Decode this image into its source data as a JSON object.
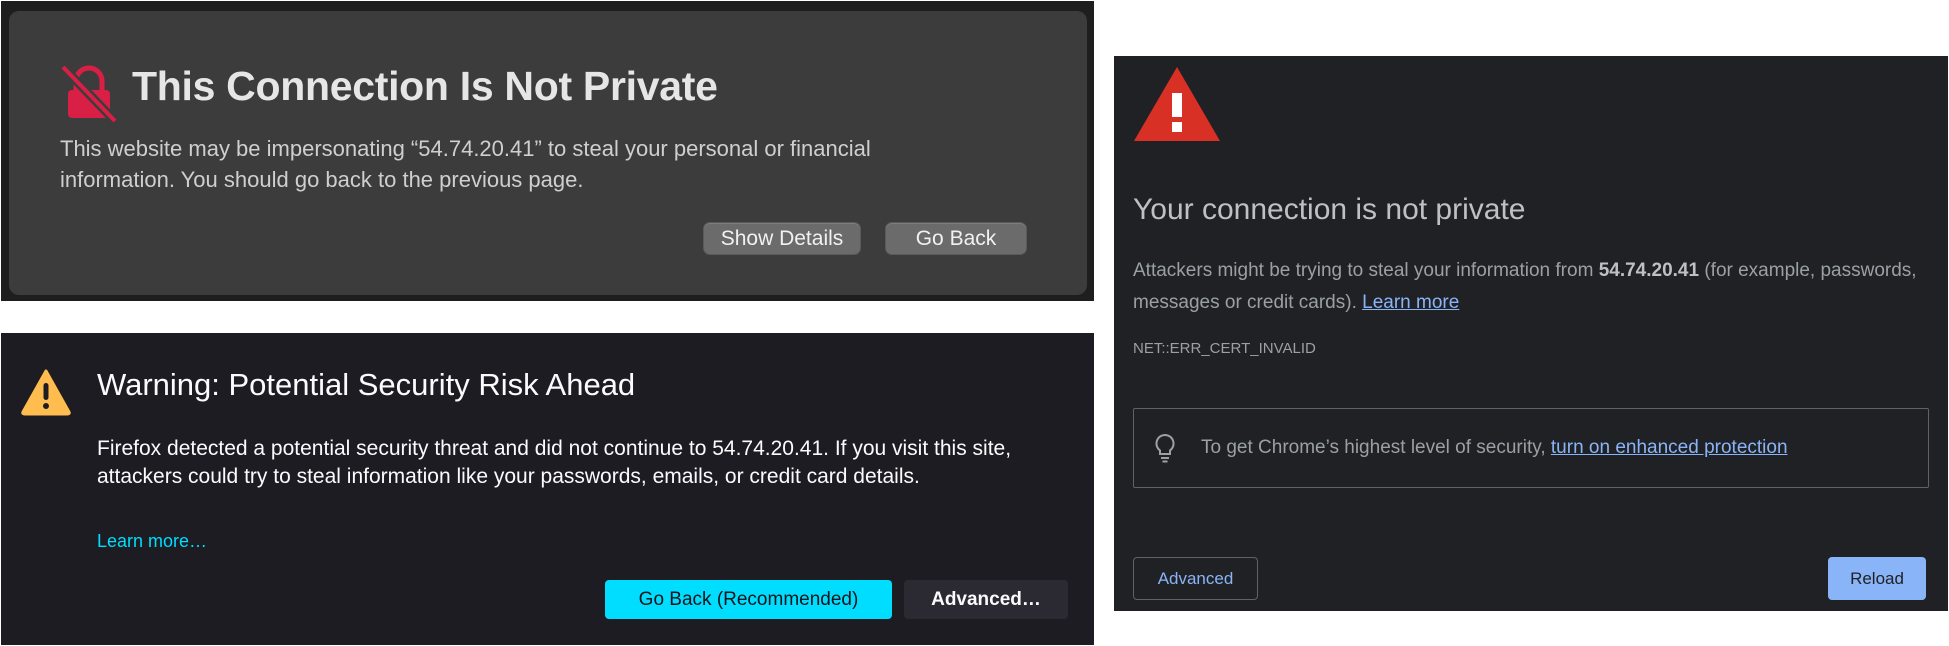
{
  "safari": {
    "title": "This Connection Is Not Private",
    "body": "This website may be impersonating “54.74.20.41” to steal your personal or financial information. You should go back to the previous page.",
    "buttons": {
      "show_details": "Show Details",
      "go_back": "Go Back"
    },
    "colors": {
      "icon": "#d91f45",
      "background": "#3c3c3d"
    }
  },
  "firefox": {
    "title": "Warning: Potential Security Risk Ahead",
    "body": "Firefox detected a potential security threat and did not continue to 54.74.20.41. If you visit this site, attackers could try to steal information like your passwords, emails, or credit card details.",
    "learn_more": "Learn more…",
    "buttons": {
      "go_back": "Go Back (Recommended)",
      "advanced": "Advanced…"
    },
    "colors": {
      "warning_icon": "#ffbd4f",
      "accent": "#00ddff"
    }
  },
  "chrome": {
    "title": "Your connection is not private",
    "body_pre": "Attackers might be trying to steal your information from ",
    "host": "54.74.20.41",
    "body_post": " (for example, passwords, messages or credit cards). ",
    "learn_more": "Learn more",
    "error_code": "NET::ERR_CERT_INVALID",
    "tip_text": "To get Chrome’s highest level of security, ",
    "tip_link": "turn on enhanced protection",
    "buttons": {
      "advanced": "Advanced",
      "reload": "Reload"
    },
    "colors": {
      "warning_icon": "#d93025",
      "link": "#8ab4f8"
    }
  }
}
